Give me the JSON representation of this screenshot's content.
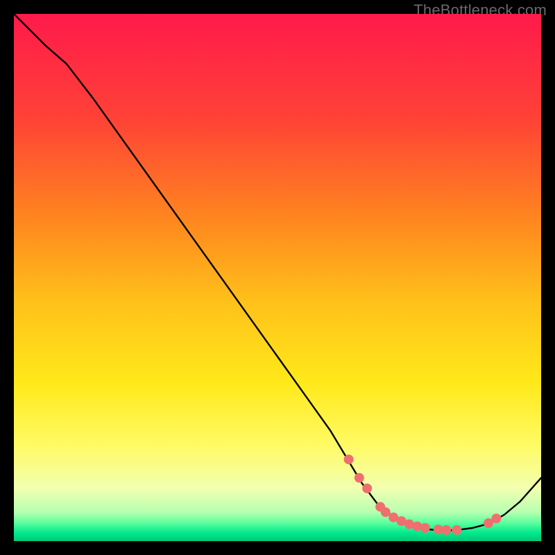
{
  "watermark": "TheBottleneck.com",
  "chart_data": {
    "type": "line",
    "title": "",
    "xlabel": "",
    "ylabel": "",
    "xlim": [
      0,
      100
    ],
    "ylim": [
      0,
      100
    ],
    "background_gradient_stops": [
      {
        "pos": 0.0,
        "color": "#ff1a4b"
      },
      {
        "pos": 0.2,
        "color": "#ff4236"
      },
      {
        "pos": 0.4,
        "color": "#ff8a1e"
      },
      {
        "pos": 0.55,
        "color": "#ffc21a"
      },
      {
        "pos": 0.7,
        "color": "#ffe91a"
      },
      {
        "pos": 0.82,
        "color": "#fffb66"
      },
      {
        "pos": 0.9,
        "color": "#f2ffb0"
      },
      {
        "pos": 0.945,
        "color": "#b8ffb0"
      },
      {
        "pos": 0.965,
        "color": "#5cff9e"
      },
      {
        "pos": 0.985,
        "color": "#00e88c"
      },
      {
        "pos": 1.0,
        "color": "#00c878"
      }
    ],
    "curve": {
      "x": [
        0,
        3,
        6,
        10,
        15,
        20,
        25,
        30,
        35,
        40,
        45,
        50,
        55,
        60,
        63,
        66,
        69,
        72,
        75,
        78,
        81,
        84,
        87,
        90,
        93,
        96,
        100
      ],
      "y": [
        100,
        97,
        94,
        90.5,
        84,
        77,
        70,
        63,
        56,
        49,
        42,
        35,
        28,
        21,
        16,
        11,
        7,
        4.5,
        3,
        2.3,
        2,
        2.1,
        2.5,
        3.3,
        5,
        7.5,
        12
      ]
    },
    "markers": {
      "x": [
        63.5,
        65.5,
        67,
        69.5,
        70.5,
        72,
        73.5,
        75,
        76.5,
        78,
        80.5,
        82,
        84,
        90,
        91.5
      ],
      "y": [
        15.5,
        12,
        10,
        6.5,
        5.5,
        4.5,
        3.8,
        3.2,
        2.8,
        2.5,
        2.2,
        2.1,
        2.1,
        3.4,
        4.3
      ],
      "color": "#ef6f6f",
      "radius": 7
    }
  }
}
